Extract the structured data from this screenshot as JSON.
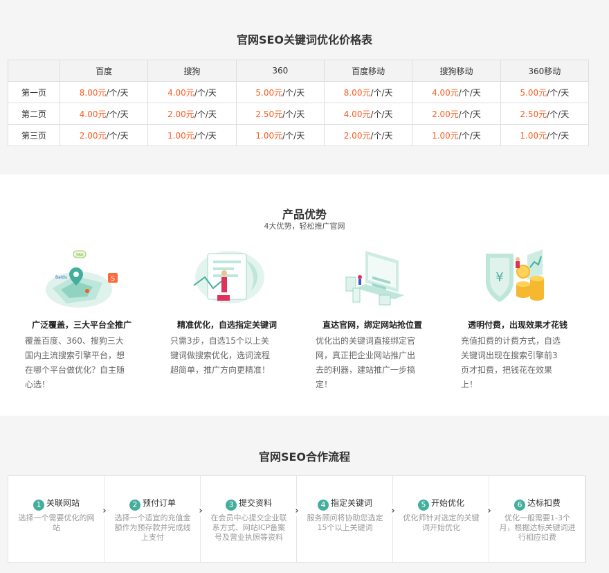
{
  "price": {
    "title": "官网SEO关键词优化价格表",
    "headers": [
      "",
      "百度",
      "搜狗",
      "360",
      "百度移动",
      "搜狗移动",
      "360移动"
    ],
    "unit": "/个/天",
    "rows": [
      {
        "label": "第一页",
        "prices": [
          "8.00元",
          "4.00元",
          "5.00元",
          "8.00元",
          "4.00元",
          "5.00元"
        ]
      },
      {
        "label": "第二页",
        "prices": [
          "4.00元",
          "2.00元",
          "2.50元",
          "4.00元",
          "2.00元",
          "2.50元"
        ]
      },
      {
        "label": "第三页",
        "prices": [
          "2.00元",
          "1.00元",
          "1.00元",
          "2.00元",
          "1.00元",
          "1.00元"
        ]
      }
    ]
  },
  "advantages": {
    "title": "产品优势",
    "subtitle": "4大优势，轻松推广官网",
    "items": [
      {
        "name": "广泛覆盖，三大平台全推广",
        "desc": "覆盖百度、360、搜狗三大国内主流搜索引擎平台，想在哪个平台做优化？自主随心选！",
        "icon": "map-platform-illustration",
        "badges": [
          "360",
          "Baidu",
          "S"
        ]
      },
      {
        "name": "精准优化，自选指定关键词",
        "desc": "只需3步，自选15个以上关键词做搜索优化，选词流程超简单，推广方向更精准！",
        "icon": "keyword-board-illustration"
      },
      {
        "name": "直达官网，绑定网站抢位置",
        "desc": "优化出的关键词直接绑定官网，真正把企业网站推广出去的利器，建站推广一步搞定！",
        "icon": "website-screen-illustration"
      },
      {
        "name": "透明付费，出现效果才花钱",
        "desc": "充值扣费的计费方式，自选关键词出现在搜索引擎前3页才扣费，把钱花在效果上！",
        "icon": "coins-shield-illustration"
      }
    ]
  },
  "process": {
    "title": "官网SEO合作流程",
    "steps": [
      {
        "num": "1",
        "title": "关联网站",
        "desc": "选择一个需要优化的网站"
      },
      {
        "num": "2",
        "title": "预付订单",
        "desc": "选择一个适宜的充值金额作为预存款并完成线上支付"
      },
      {
        "num": "3",
        "title": "提交资料",
        "desc": "在会员中心提交企业联系方式、网站ICP备案号及营业执照等资料"
      },
      {
        "num": "4",
        "title": "指定关键词",
        "desc": "服务顾问将协助您选定15个以上关键词"
      },
      {
        "num": "5",
        "title": "开始优化",
        "desc": "优化师针对选定的关键词开始优化"
      },
      {
        "num": "6",
        "title": "达标扣费",
        "desc": "优化一般需要1-3个月，根据达标关键词进行相应扣费"
      }
    ],
    "arrow_glyph": "›"
  },
  "colors": {
    "accent": "#43ae9b",
    "price": "#ff5a1f",
    "section_bg": "#f5f5f5"
  }
}
